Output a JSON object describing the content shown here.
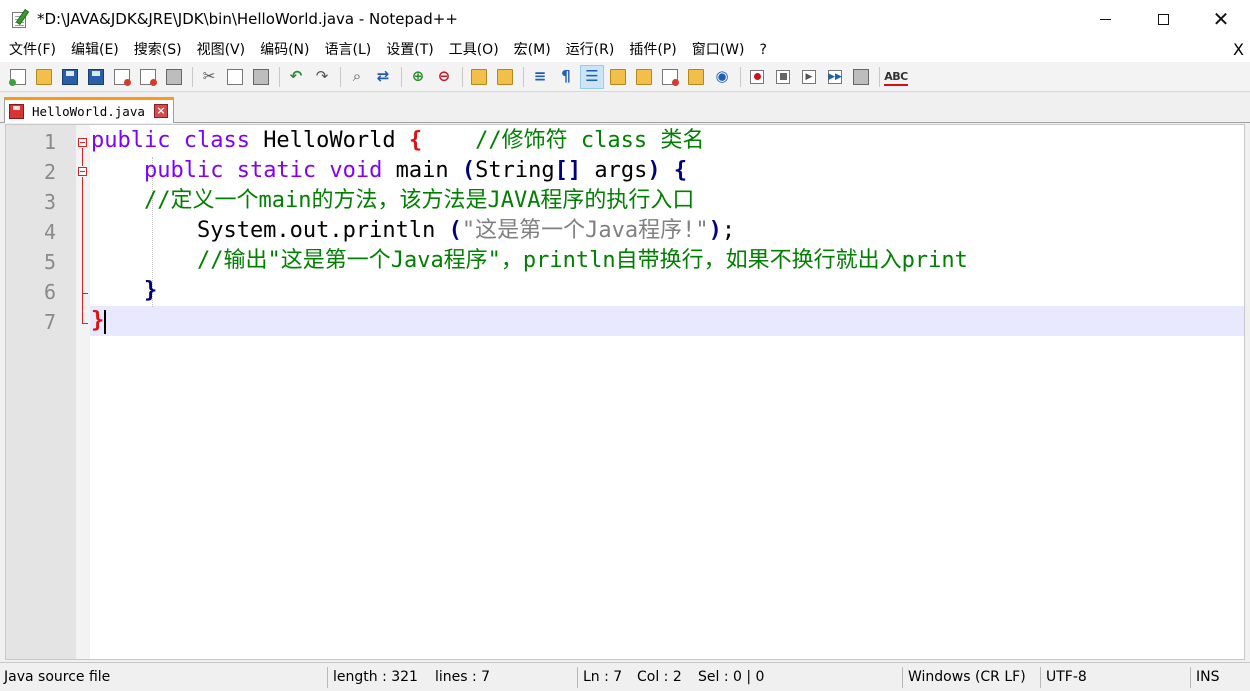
{
  "window": {
    "title": "*D:\\JAVA&JDK&JRE\\JDK\\bin\\HelloWorld.java - Notepad++",
    "minimize": "",
    "maximize": "",
    "close": "✕"
  },
  "menu": {
    "items": [
      "文件(F)",
      "编辑(E)",
      "搜索(S)",
      "视图(V)",
      "编码(N)",
      "语言(L)",
      "设置(T)",
      "工具(O)",
      "宏(M)",
      "运行(R)",
      "插件(P)",
      "窗口(W)",
      "?"
    ],
    "close_doc": "X"
  },
  "toolbar": {
    "icons": [
      "new-file-icon",
      "open-file-icon",
      "save-icon",
      "save-all-icon",
      "close-icon",
      "close-all-icon",
      "print-icon",
      "cut-icon",
      "copy-icon",
      "paste-icon",
      "undo-icon",
      "redo-icon",
      "find-icon",
      "replace-icon",
      "zoom-in-icon",
      "zoom-out-icon",
      "sync-vertical-icon",
      "sync-horizontal-icon",
      "word-wrap-icon",
      "show-all-chars-icon",
      "indent-guide-icon",
      "udl-icon",
      "doc-map-icon",
      "function-list-icon",
      "folder-workspace-icon",
      "monitoring-icon",
      "record-macro-icon",
      "stop-record-icon",
      "play-macro-icon",
      "run-macro-multiple-icon",
      "save-macro-icon",
      "spell-check-icon"
    ],
    "spell_label": "ABC"
  },
  "tabs": [
    {
      "label": "HelloWorld.java",
      "active": true
    }
  ],
  "editor": {
    "line_numbers": [
      "1",
      "2",
      "3",
      "4",
      "5",
      "6",
      "7"
    ],
    "lines": [
      [
        {
          "t": "kw",
          "v": "public class "
        },
        {
          "t": "plain",
          "v": "HelloWorld "
        },
        {
          "t": "br-red",
          "v": "{"
        },
        {
          "t": "plain",
          "v": "    "
        },
        {
          "t": "cm",
          "v": "//修饰符 class 类名"
        }
      ],
      [
        {
          "t": "plain",
          "v": "    "
        },
        {
          "t": "kw",
          "v": "public static void "
        },
        {
          "t": "plain",
          "v": "main "
        },
        {
          "t": "br",
          "v": "("
        },
        {
          "t": "plain",
          "v": "String"
        },
        {
          "t": "br",
          "v": "[]"
        },
        {
          "t": "plain",
          "v": " args"
        },
        {
          "t": "br",
          "v": ")"
        },
        {
          "t": "plain",
          "v": " "
        },
        {
          "t": "br",
          "v": "{"
        }
      ],
      [
        {
          "t": "plain",
          "v": "    "
        },
        {
          "t": "cm",
          "v": "//定义一个main的方法，该方法是JAVA程序的执行入口"
        }
      ],
      [
        {
          "t": "plain",
          "v": "        System.out.println "
        },
        {
          "t": "br",
          "v": "("
        },
        {
          "t": "str",
          "v": "\"这是第一个Java程序!\""
        },
        {
          "t": "br",
          "v": ")"
        },
        {
          "t": "plain",
          "v": ";"
        }
      ],
      [
        {
          "t": "plain",
          "v": "        "
        },
        {
          "t": "cm",
          "v": "//输出\"这是第一个Java程序\"，println自带换行，如果不换行就出入print"
        }
      ],
      [
        {
          "t": "plain",
          "v": "    "
        },
        {
          "t": "br",
          "v": "}"
        }
      ],
      [
        {
          "t": "br-red",
          "v": "}"
        }
      ]
    ]
  },
  "status": {
    "file_type": "Java source file",
    "length": "length : 321",
    "lines": "lines : 7",
    "ln": "Ln : 7",
    "col": "Col : 2",
    "sel": "Sel : 0 | 0",
    "eol": "Windows (CR LF)",
    "encoding": "UTF-8",
    "mode": "INS"
  }
}
